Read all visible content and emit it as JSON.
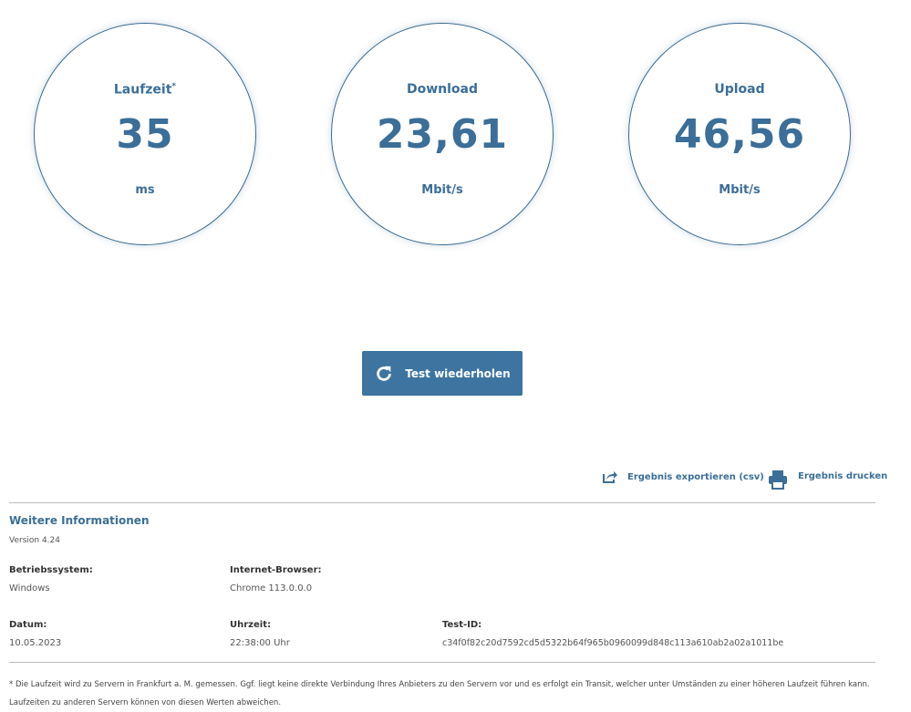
{
  "metrics": [
    {
      "label": "Laufzeit",
      "sup": "*",
      "value": "35",
      "unit": "ms"
    },
    {
      "label": "Download",
      "sup": "",
      "value": "23,61",
      "unit": "Mbit/s"
    },
    {
      "label": "Upload",
      "sup": "",
      "value": "46,56",
      "unit": "Mbit/s"
    }
  ],
  "retest_button": {
    "label": "Test wiederholen",
    "icon": "refresh-icon"
  },
  "actions": {
    "export": "Ergebnis exportieren (csv)",
    "print": "Ergebnis drucken"
  },
  "info": {
    "title": "Weitere Informationen",
    "version": "Version 4.24",
    "os_label": "Betriebssystem:",
    "os": "Windows",
    "browser_label": "Internet-Browser:",
    "browser": "Chrome 113.0.0.0",
    "date_label": "Datum:",
    "date": "10.05.2023",
    "time_label": "Uhrzeit:",
    "time": "22:38:00 Uhr",
    "id_label": "Test-ID:",
    "id": "c34f0f82c20d7592cd5d5322b64f965b0960099d848c113a610ab2a02a1011be"
  },
  "footnote": "* Die Laufzeit wird zu Servern in Frankfurt a. M. gemessen. Ggf. liegt keine direkte Verbindung Ihres Anbieters zu den Servern vor und es erfolgt ein Transit, welcher unter Umständen zu einer höheren Laufzeit führen kann. Laufzeiten zu anderen Servern können von diesen Werten abweichen.",
  "colors": {
    "accent": "#3d74a0"
  }
}
